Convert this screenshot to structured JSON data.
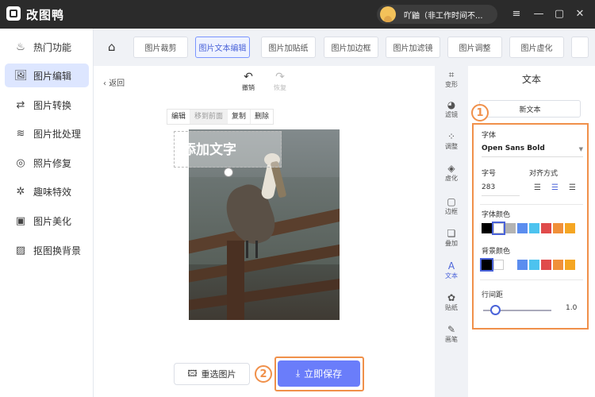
{
  "app": {
    "title": "改图鸭",
    "user": "吖鼬（非工作时间不...",
    "window_controls": [
      "≡",
      "—",
      "▢",
      "✕"
    ]
  },
  "sidebar": {
    "items": [
      {
        "label": "热门功能",
        "icon": "flame-icon",
        "glyph": "♨"
      },
      {
        "label": "图片编辑",
        "icon": "image-edit-icon",
        "glyph": "🖼"
      },
      {
        "label": "图片转换",
        "icon": "convert-icon",
        "glyph": "⇄"
      },
      {
        "label": "图片批处理",
        "icon": "batch-icon",
        "glyph": "≋"
      },
      {
        "label": "照片修复",
        "icon": "repair-icon",
        "glyph": "◎"
      },
      {
        "label": "趣味特效",
        "icon": "sparkle-icon",
        "glyph": "✲"
      },
      {
        "label": "图片美化",
        "icon": "beautify-icon",
        "glyph": "▣"
      },
      {
        "label": "抠图换背景",
        "icon": "cutout-icon",
        "glyph": "▨"
      }
    ],
    "active_index": 1
  },
  "toolbar": {
    "home_icon": "home-icon",
    "tabs": [
      "图片裁剪",
      "图片文本编辑",
      "图片加贴纸",
      "图片加边框",
      "图片加滤镜",
      "图片调整",
      "图片虚化"
    ],
    "active_index": 1
  },
  "canvas": {
    "back_label": "返回",
    "undo_label": "撤销",
    "redo_label": "恢复",
    "text_toolbar": [
      "编辑",
      "移到前面",
      "复制",
      "删除"
    ],
    "text_overlay": "添加文字",
    "reselect_label": "重选图片",
    "save_label": "立即保存",
    "badge2": "2"
  },
  "tools": [
    {
      "label": "变形",
      "glyph": "⌗"
    },
    {
      "label": "滤镜",
      "glyph": "◕"
    },
    {
      "label": "调整",
      "glyph": "⁘"
    },
    {
      "label": "虚化",
      "glyph": "◈"
    },
    {
      "label": "边框",
      "glyph": "▢"
    },
    {
      "label": "叠加",
      "glyph": "❏"
    },
    {
      "label": "文本",
      "glyph": "A"
    },
    {
      "label": "贴纸",
      "glyph": "✿"
    },
    {
      "label": "画笔",
      "glyph": "✎"
    }
  ],
  "active_tool": 6,
  "panel": {
    "title": "文本",
    "new_text": "新文本",
    "badge1": "1",
    "font_label": "字体",
    "font_value": "Open Sans Bold",
    "size_label": "字号",
    "size_value": "283",
    "align_label": "对齐方式",
    "font_color_label": "字体颜色",
    "bg_color_label": "背景颜色",
    "line_spacing_label": "行间距",
    "line_spacing_value": "1.0",
    "line_spacing_level": 0.13,
    "font_colors": [
      "#000000",
      "#ffffff",
      "#b3b3b3",
      "#5b8def",
      "#4dc3ef",
      "#e04b4b",
      "#f0903a",
      "#f5a623"
    ],
    "bg_colors": [
      "#000000",
      "#ffffff",
      "#5b8def",
      "#4dc3ef",
      "#e04b4b",
      "#f0903a",
      "#f5a623"
    ]
  },
  "accent": "#6a7dfa",
  "highlight": "#f0904a"
}
